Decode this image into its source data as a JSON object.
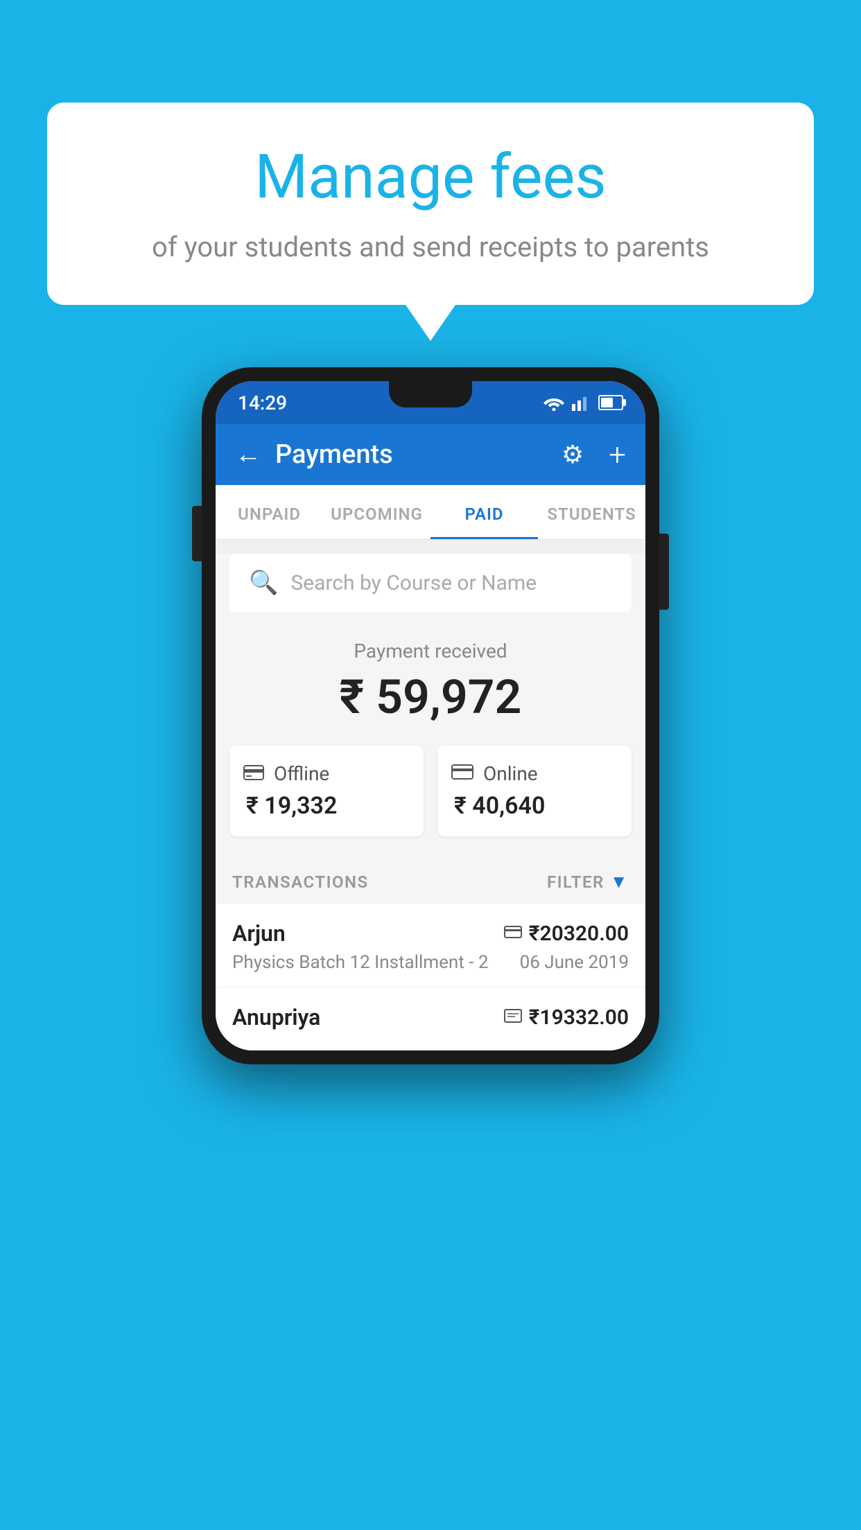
{
  "page": {
    "background_color": "#1ab3e8"
  },
  "bubble": {
    "title": "Manage fees",
    "subtitle": "of your students and send receipts to parents"
  },
  "status_bar": {
    "time": "14:29"
  },
  "header": {
    "title": "Payments",
    "back_label": "←",
    "plus_label": "+",
    "gear_label": "⚙"
  },
  "tabs": [
    {
      "label": "UNPAID",
      "active": false
    },
    {
      "label": "UPCOMING",
      "active": false
    },
    {
      "label": "PAID",
      "active": true
    },
    {
      "label": "STUDENTS",
      "active": false
    }
  ],
  "search": {
    "placeholder": "Search by Course or Name"
  },
  "payment_received": {
    "label": "Payment received",
    "amount": "₹ 59,972"
  },
  "cards": [
    {
      "icon": "💳",
      "label": "Offline",
      "amount": "₹ 19,332"
    },
    {
      "icon": "💳",
      "label": "Online",
      "amount": "₹ 40,640"
    }
  ],
  "transactions_section": {
    "label": "TRANSACTIONS",
    "filter_label": "FILTER"
  },
  "transactions": [
    {
      "name": "Arjun",
      "amount": "₹20320.00",
      "icon": "💳",
      "course": "Physics Batch 12 Installment - 2",
      "date": "06 June 2019"
    },
    {
      "name": "Anupriya",
      "amount": "₹19332.00",
      "icon": "💵",
      "course": "",
      "date": ""
    }
  ]
}
